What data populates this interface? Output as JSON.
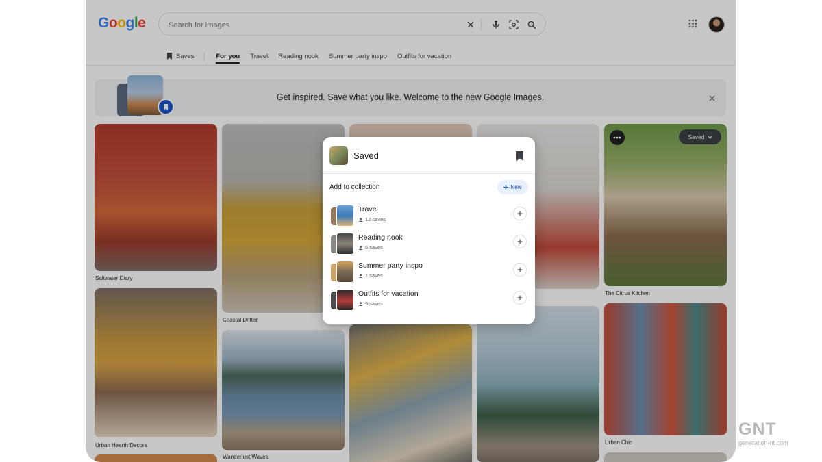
{
  "brand": {
    "logo_letters": [
      "G",
      "o",
      "o",
      "g",
      "l",
      "e"
    ],
    "logo_colors": [
      "#4285f4",
      "#ea4335",
      "#fbbc05",
      "#4285f4",
      "#34a853",
      "#ea4335"
    ]
  },
  "search": {
    "placeholder": "Search for images",
    "icons": [
      "clear-icon",
      "mic-icon",
      "lens-icon",
      "search-icon"
    ]
  },
  "nav": {
    "saves_label": "Saves",
    "tabs": [
      {
        "label": "For you",
        "active": true
      },
      {
        "label": "Travel",
        "active": false
      },
      {
        "label": "Reading nook",
        "active": false
      },
      {
        "label": "Summer party inspo",
        "active": false
      },
      {
        "label": "Outfits for vacation",
        "active": false
      }
    ]
  },
  "banner": {
    "text": "Get inspired. Save what you like. Welcome to the new Google Images."
  },
  "grid": {
    "captions": {
      "saltwater": "Saltwater Diary",
      "coastal": "Coastal Drifter",
      "citrus": "The Citrus Kitchen",
      "urban_hearth": "Urban Hearth Decors",
      "wanderlust": "Wanderlust Waves",
      "urban_chic": "Urban Chic"
    },
    "saved_label": "Saved"
  },
  "popup": {
    "title": "Saved",
    "add_to_collection": "Add to collection",
    "new_label": "New",
    "collections": [
      {
        "name": "Travel",
        "saves": "12 saves"
      },
      {
        "name": "Reading nook",
        "saves": "6 saves"
      },
      {
        "name": "Summer party inspo",
        "saves": "7 saves"
      },
      {
        "name": "Outfits for vacation",
        "saves": "9 saves"
      }
    ]
  },
  "watermark": {
    "big": "GNT",
    "small": "generation-nt.com"
  },
  "colors": {
    "accent_blue": "#1a73e8",
    "text_primary": "#202124",
    "text_secondary": "#5f6368"
  }
}
